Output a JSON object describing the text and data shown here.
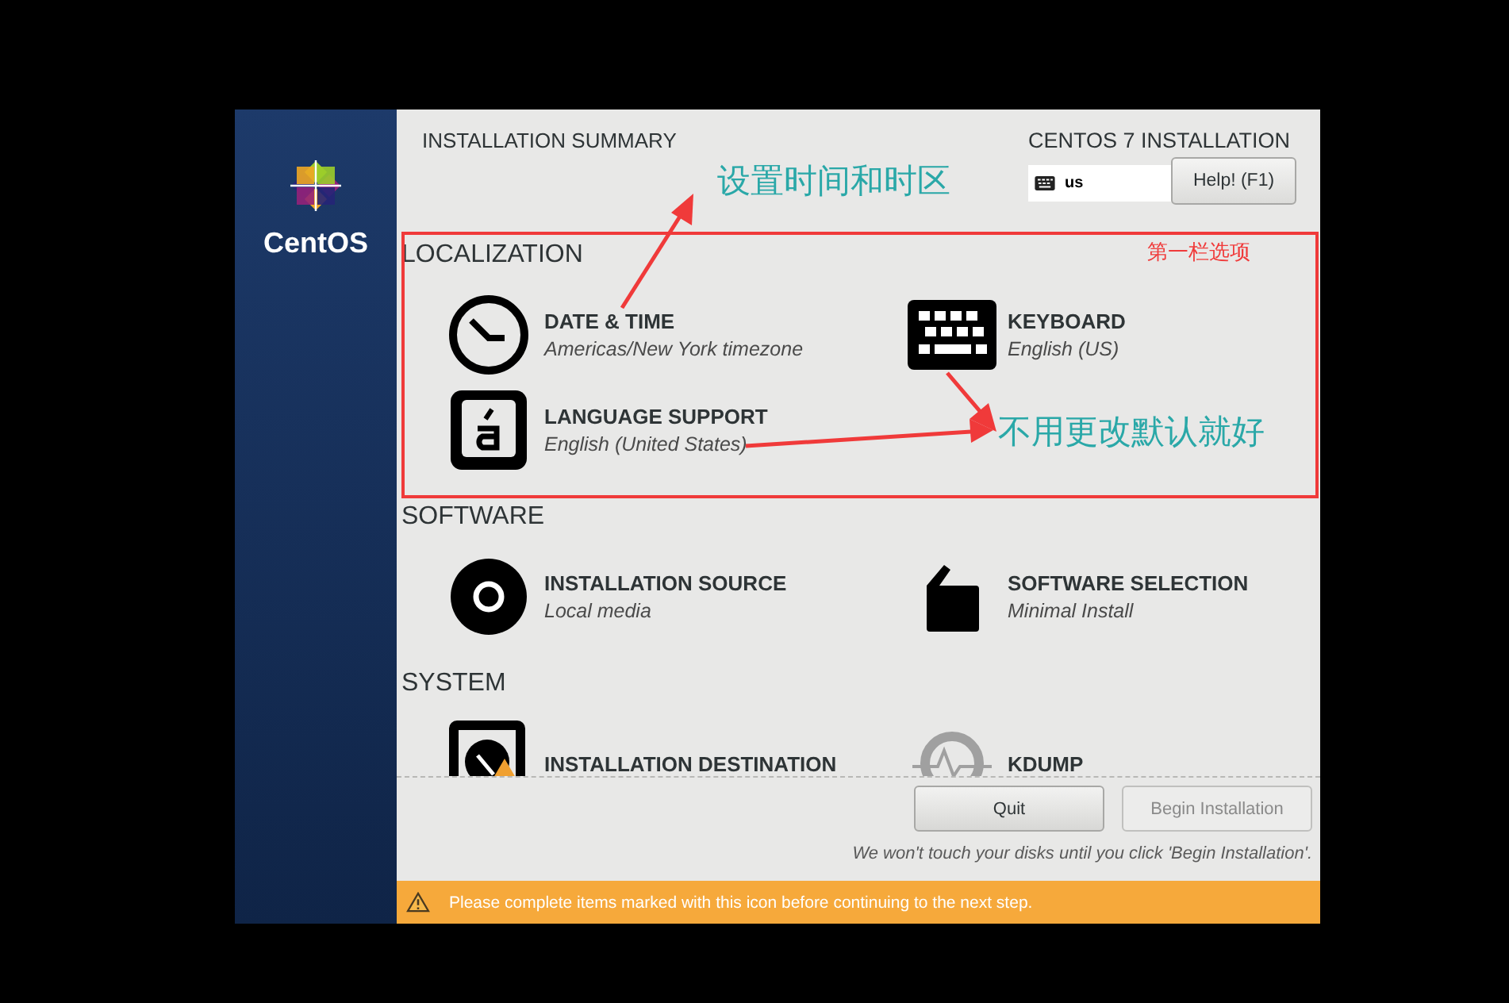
{
  "sidebar": {
    "logo_text": "CentOS"
  },
  "header": {
    "title": "INSTALLATION SUMMARY",
    "product": "CENTOS 7 INSTALLATION",
    "keyboard_layout": "us",
    "help_button": "Help! (F1)"
  },
  "sections": [
    {
      "title": "LOCALIZATION",
      "spokes": [
        {
          "kind": "clock",
          "title": "DATE & TIME",
          "status": "Americas/New York timezone",
          "warning": false,
          "disabled": false
        },
        {
          "kind": "keyboard",
          "title": "KEYBOARD",
          "status": "English (US)",
          "warning": false,
          "disabled": false
        },
        {
          "kind": "language",
          "title": "LANGUAGE SUPPORT",
          "status": "English (United States)",
          "warning": false,
          "disabled": false
        }
      ]
    },
    {
      "title": "SOFTWARE",
      "spokes": [
        {
          "kind": "disc",
          "title": "INSTALLATION SOURCE",
          "status": "Local media",
          "warning": false,
          "disabled": false
        },
        {
          "kind": "package",
          "title": "SOFTWARE SELECTION",
          "status": "Minimal Install",
          "warning": false,
          "disabled": false
        }
      ]
    },
    {
      "title": "SYSTEM",
      "spokes": [
        {
          "kind": "disk",
          "title": "INSTALLATION DESTINATION",
          "warning": true,
          "disabled": false
        },
        {
          "kind": "kdump",
          "title": "KDUMP",
          "warning": false,
          "disabled": true
        }
      ]
    }
  ],
  "buttons": [
    {
      "label": "Quit",
      "disabled": false
    },
    {
      "label": "Begin Installation",
      "disabled": true
    }
  ],
  "footer_note": "We won't touch your disks until you click 'Begin Installation'.",
  "warning_bar": "Please complete items marked with this icon before continuing to the next step.",
  "annotations": {
    "box_label": "第一栏选项",
    "callouts": [
      "设置时间和时区",
      "不用更改默认就好"
    ]
  }
}
